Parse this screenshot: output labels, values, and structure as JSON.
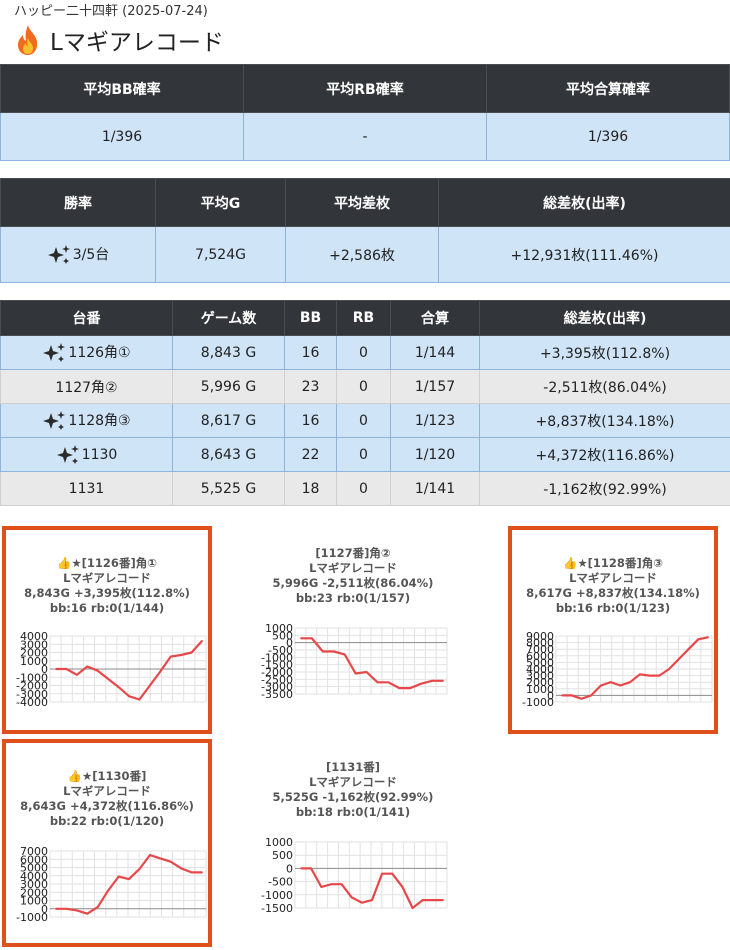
{
  "header": {
    "subtitle": "ハッピー二十四軒 (2025-07-24)",
    "title": "Lマギアレコード",
    "title_icon": "fire-icon"
  },
  "summary1": {
    "headers": [
      "平均BB確率",
      "平均RB確率",
      "平均合算確率"
    ],
    "values": [
      "1/396",
      "-",
      "1/396"
    ]
  },
  "summary2": {
    "headers": [
      "勝率",
      "平均G",
      "平均差枚",
      "総差枚(出率)"
    ],
    "win_rate": "3/5台",
    "avg_games": "7,524G",
    "avg_diff": "+2,586枚",
    "total_diff": "+12,931枚(111.46%)"
  },
  "machines": {
    "headers": [
      "台番",
      "ゲーム数",
      "BB",
      "RB",
      "合算",
      "総差枚(出率)"
    ],
    "rows": [
      {
        "num": "1126角①",
        "games": "8,843 G",
        "bb": "16",
        "rb": "0",
        "total": "1/144",
        "diff": "+3,395枚(112.8%)",
        "win": true
      },
      {
        "num": "1127角②",
        "games": "5,996 G",
        "bb": "23",
        "rb": "0",
        "total": "1/157",
        "diff": "-2,511枚(86.04%)",
        "win": false
      },
      {
        "num": "1128角③",
        "games": "8,617 G",
        "bb": "16",
        "rb": "0",
        "total": "1/123",
        "diff": "+8,837枚(134.18%)",
        "win": true
      },
      {
        "num": "1130",
        "games": "8,643 G",
        "bb": "22",
        "rb": "0",
        "total": "1/120",
        "diff": "+4,372枚(116.86%)",
        "win": true
      },
      {
        "num": "1131",
        "games": "5,525 G",
        "bb": "18",
        "rb": "0",
        "total": "1/141",
        "diff": "-1,162枚(92.99%)",
        "win": false
      }
    ]
  },
  "panels": [
    {
      "line1": "👍★[1126番]角①",
      "line2": "Lマギアレコード",
      "line3": "8,843G +3,395枚(112.8%)",
      "line4": "bb:16 rb:0(1/144)",
      "highlight": true
    },
    {
      "line1": "[1127番]角②",
      "line2": "Lマギアレコード",
      "line3": "5,996G -2,511枚(86.04%)",
      "line4": "bb:23 rb:0(1/157)",
      "highlight": false
    },
    {
      "line1": "👍★[1128番]角③",
      "line2": "Lマギアレコード",
      "line3": "8,617G +8,837枚(134.18%)",
      "line4": "bb:16 rb:0(1/123)",
      "highlight": true
    },
    {
      "line1": "👍★[1130番]",
      "line2": "Lマギアレコード",
      "line3": "8,643G +4,372枚(116.86%)",
      "line4": "bb:22 rb:0(1/120)",
      "highlight": true
    },
    {
      "line1": "[1131番]",
      "line2": "Lマギアレコード",
      "line3": "5,525G -1,162枚(92.99%)",
      "line4": "bb:18 rb:0(1/141)",
      "highlight": false
    }
  ],
  "colors": {
    "line": "#e8474a",
    "highlight_border": "#e0501a",
    "header_bg": "#323539",
    "row_blue": "#cfe4f7",
    "row_gray": "#e9e9e9",
    "positive_text": "#3a86d4"
  },
  "chart_data": [
    {
      "type": "line",
      "ylim": [
        -4000,
        4000
      ],
      "yticks": [
        "4000",
        "3000",
        "2000",
        "1000",
        "0",
        "-1000",
        "-2000",
        "-3000",
        "-4000"
      ],
      "series": [
        {
          "values": [
            0,
            0,
            -700,
            300,
            -200,
            -1200,
            -2200,
            -3300,
            -3700,
            -2000,
            -300,
            1500,
            1700,
            2000,
            3400
          ]
        }
      ]
    },
    {
      "type": "line",
      "ylim": [
        -3500,
        1000
      ],
      "yticks": [
        "1000",
        "500",
        "0",
        "-500",
        "-1000",
        "-1500",
        "-2000",
        "-2500",
        "-3000",
        "-3500"
      ],
      "series": [
        {
          "values": [
            300,
            300,
            -600,
            -600,
            -800,
            -2100,
            -2000,
            -2700,
            -2700,
            -3100,
            -3100,
            -2800,
            -2600,
            -2600
          ]
        }
      ]
    },
    {
      "type": "line",
      "ylim": [
        -1000,
        9000
      ],
      "yticks": [
        "9000",
        "8000",
        "7000",
        "6000",
        "5000",
        "4000",
        "3000",
        "2000",
        "1000",
        "0",
        "-1000"
      ],
      "series": [
        {
          "values": [
            0,
            0,
            -500,
            0,
            1500,
            2000,
            1500,
            2000,
            3200,
            3000,
            3000,
            4000,
            5500,
            7000,
            8500,
            8800
          ]
        }
      ]
    },
    {
      "type": "line",
      "ylim": [
        -1000,
        7000
      ],
      "yticks": [
        "7000",
        "6000",
        "5000",
        "4000",
        "3000",
        "2000",
        "1000",
        "0",
        "-1000"
      ],
      "series": [
        {
          "values": [
            0,
            0,
            -200,
            -600,
            200,
            2200,
            3900,
            3600,
            4800,
            6500,
            6100,
            5700,
            4900,
            4400,
            4400
          ]
        }
      ]
    },
    {
      "type": "line",
      "ylim": [
        -1500,
        1000
      ],
      "yticks": [
        "1000",
        "500",
        "0",
        "-500",
        "-1000",
        "-1500"
      ],
      "series": [
        {
          "values": [
            0,
            0,
            -700,
            -600,
            -600,
            -1100,
            -1300,
            -1200,
            -200,
            -200,
            -700,
            -1500,
            -1200,
            -1200,
            -1200
          ]
        }
      ]
    }
  ]
}
